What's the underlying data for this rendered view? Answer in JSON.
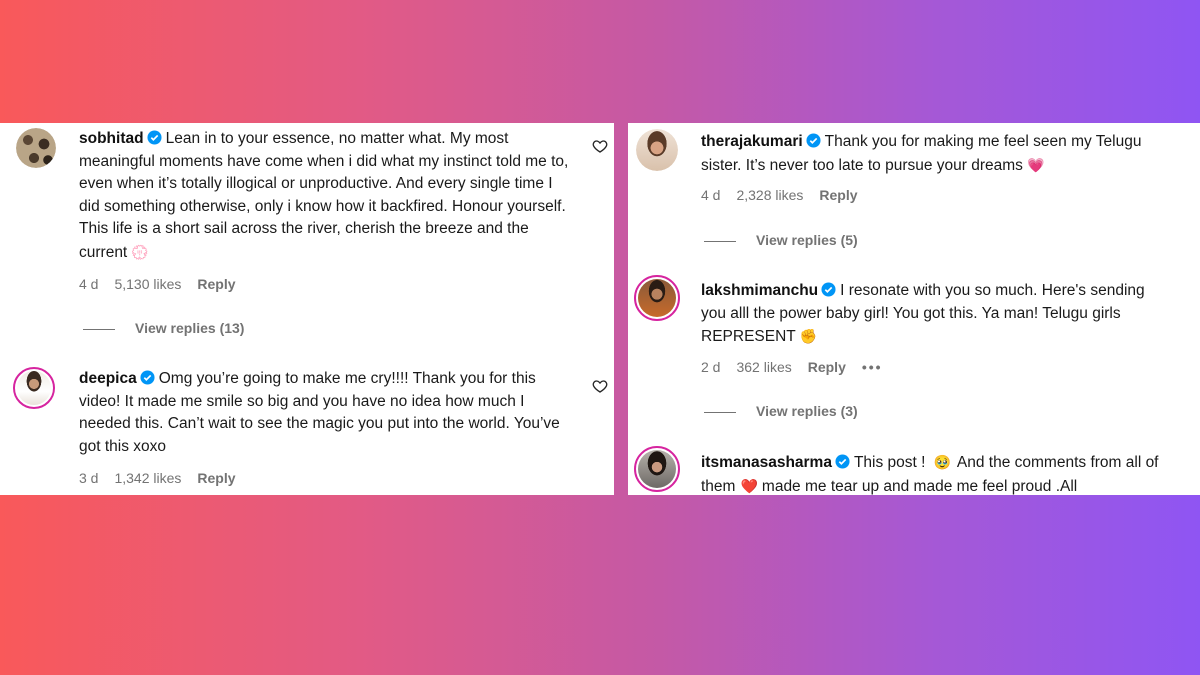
{
  "left": {
    "comments": [
      {
        "username": "sobhitad",
        "text": "Lean in to your essence, no matter what. My most meaningful moments have come when i did what my instinct told me to, even when it’s totally illogical or unproductive. And every single time I did something otherwise, only i know how it backfired. Honour yourself. This life is a short sail across the river, cherish the breeze and the current",
        "emoji": "💮",
        "time": "4 d",
        "likes": "5,130 likes",
        "reply": "Reply",
        "view_replies": "View replies (13)"
      },
      {
        "username": "deepica",
        "text": "Omg you’re going to make me cry!!!! Thank you for this video! It made me smile so big and you have no idea how much I needed this. Can’t wait to see the magic you put into the world. You’ve got this xoxo",
        "time": "3 d",
        "likes": "1,342 likes",
        "reply": "Reply"
      }
    ]
  },
  "right": {
    "comments": [
      {
        "username": "therajakumari",
        "text": "Thank you for making me feel seen my Telugu sister. It’s never too late to pursue your dreams",
        "emoji": "💗",
        "time": "4 d",
        "likes": "2,328 likes",
        "reply": "Reply",
        "view_replies": "View replies (5)"
      },
      {
        "username": "lakshmimanchu",
        "text": "I resonate with you so much. Here's sending you alll the power baby girl! You got this. Ya man! Telugu girls REPRESENT",
        "emoji": "✊",
        "time": "2 d",
        "likes": "362 likes",
        "reply": "Reply",
        "more": "•••",
        "view_replies": "View replies (3)"
      },
      {
        "username": "itsmanasasharma",
        "text_a": "This post !",
        "emoji_a": "🥹",
        "text_b": "And the comments from all of them",
        "emoji_b": "❤️",
        "text_c": "made me tear up and made me feel proud .All"
      }
    ]
  },
  "colors": {
    "verified": "#0095f6",
    "meta": "#737373",
    "ring": "#d6249f"
  },
  "icons": {
    "verified": "verified-badge-icon",
    "like": "heart-outline-icon"
  }
}
